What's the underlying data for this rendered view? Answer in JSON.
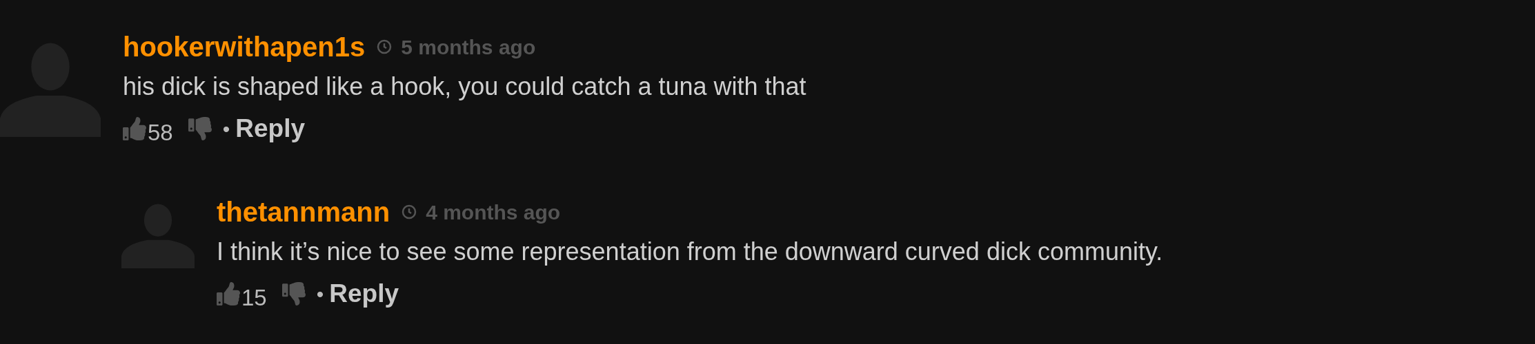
{
  "comments": [
    {
      "username": "hookerwithapen1s",
      "time": "5 months ago",
      "text": "his dick is shaped like a hook, you could catch a tuna with that",
      "likes": "58",
      "separator": "•",
      "reply": "Reply",
      "children": [
        {
          "username": "thetannmann",
          "time": "4 months ago",
          "text": "I think it’s nice to see some representation from the downward curved dick community.",
          "likes": "15",
          "separator": "•",
          "reply": "Reply"
        }
      ]
    }
  ]
}
